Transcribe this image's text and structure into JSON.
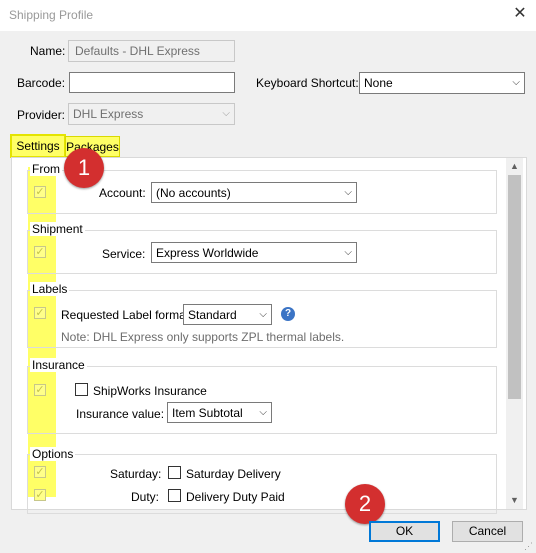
{
  "window": {
    "title": "Shipping Profile"
  },
  "form": {
    "name_label": "Name:",
    "name_value": "Defaults - DHL Express",
    "barcode_label": "Barcode:",
    "barcode_value": "",
    "shortcut_label": "Keyboard Shortcut:",
    "shortcut_value": "None",
    "provider_label": "Provider:",
    "provider_value": "DHL Express"
  },
  "tabs": [
    {
      "label": "Settings",
      "selected": true
    },
    {
      "label": "Packages",
      "selected": false
    }
  ],
  "groups": {
    "from": {
      "title": "From",
      "account_label": "Account:",
      "account_value": "(No accounts)"
    },
    "shipment": {
      "title": "Shipment",
      "service_label": "Service:",
      "service_value": "Express Worldwide"
    },
    "labels": {
      "title": "Labels",
      "format_label": "Requested Label format:",
      "format_value": "Standard",
      "note": "Note: DHL Express only supports ZPL thermal labels."
    },
    "insurance": {
      "title": "Insurance",
      "shipworks_label": "ShipWorks Insurance",
      "value_label": "Insurance value:",
      "value_value": "Item Subtotal"
    },
    "options": {
      "title": "Options",
      "saturday_label": "Saturday:",
      "saturday_check": "Saturday Delivery",
      "duty_label": "Duty:",
      "duty_check": "Delivery Duty Paid"
    }
  },
  "annotations": {
    "badge1": "1",
    "badge2": "2"
  },
  "buttons": {
    "ok": "OK",
    "cancel": "Cancel"
  },
  "colors": {
    "highlight": "#ffff66",
    "badge": "#d32f2f",
    "focus": "#0078d7"
  }
}
